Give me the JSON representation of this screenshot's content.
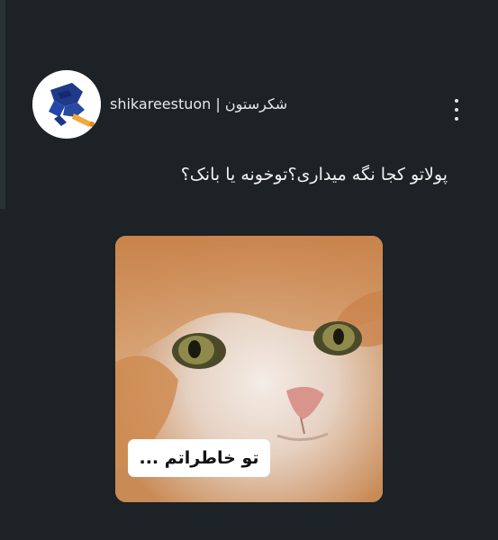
{
  "post": {
    "username": "shikareestuon | شکرستون",
    "caption": "پولاتو کجا نگه میداری؟توخونه یا بانک؟",
    "image_text": "تو خاطراتم ...",
    "more_icon": "more-vertical-icon",
    "avatar_icon": "cartoon-hand-avatar"
  }
}
